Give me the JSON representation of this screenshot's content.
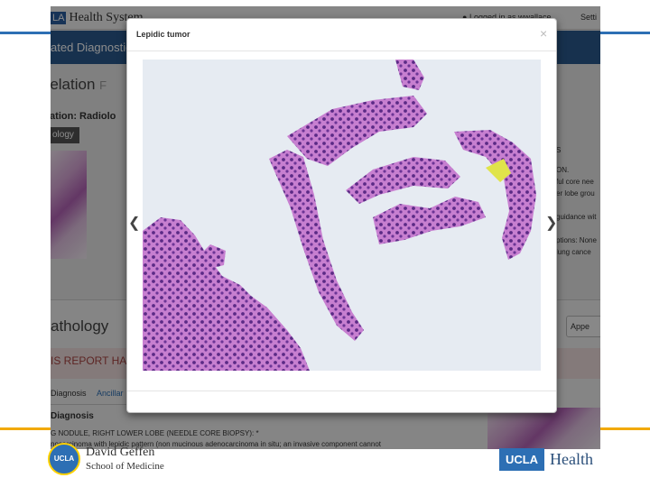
{
  "app": {
    "brand_box": "LA",
    "brand_name": "Health System",
    "user_label": "Logged in as wwallace",
    "settings_label": "Setti",
    "nav_title": "ated Diagnostic R"
  },
  "background": {
    "section_title": "rrelation",
    "section_suffix": "F",
    "subtitle": "lation: Radiolo",
    "tab_label": "ology",
    "pathology_title": "athology",
    "append_button": "Appe",
    "warning_text": "IS REPORT HA",
    "diag_tab_1": "Diagnosis",
    "diag_tab_2": "Ancillar",
    "diag_head": "Diagnosis",
    "diag_line_1": "G NODULE, RIGHT LOWER LOBE (NEEDLE CORE BIOPSY): *",
    "diag_line_2": "nocarcinoma with lepidic pattern (non mucinous adenocarcinoma in situ; an invasive component cannot",
    "right_notes": [
      "S",
      "ON.",
      "ful core nee",
      "er lobe grou",
      "guidance wit",
      "ptions: None",
      "lung cance"
    ]
  },
  "modal": {
    "title": "Lepidic tumor",
    "close": "×",
    "prev": "❮",
    "next": "❯"
  },
  "footer": {
    "seal": "UCLA",
    "school_line1": "David Geffen",
    "school_line2": "School of Medicine",
    "health_box": "UCLA",
    "health_text": "Health"
  }
}
